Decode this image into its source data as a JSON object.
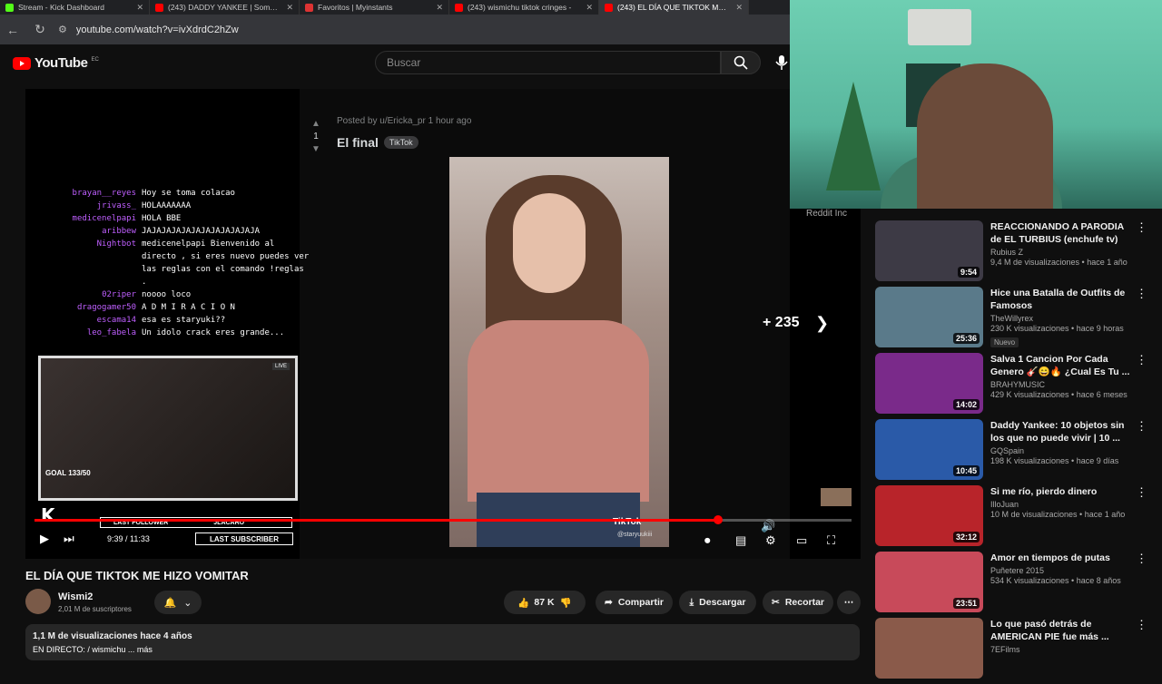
{
  "tabs": [
    {
      "label": "Stream - Kick Dashboard",
      "color": "#53fc18",
      "active": false
    },
    {
      "label": "(243) DADDY YANKEE | Somos ...",
      "color": "#ff0000",
      "active": false
    },
    {
      "label": "Favoritos | Myinstants",
      "color": "#d33",
      "active": false
    },
    {
      "label": "(243) wismichu tiktok cringes -",
      "color": "#ff0000",
      "active": false
    },
    {
      "label": "(243) EL DÍA QUE TIKTOK ME H",
      "color": "#ff0000",
      "active": true
    }
  ],
  "address": {
    "url": "youtube.com/watch?v=ivXdrdC2hZw"
  },
  "header": {
    "logo_text": "YouTube",
    "logo_sup": "EC",
    "search_placeholder": "Buscar"
  },
  "post": {
    "posted_by": "Posted by u/Ericka_pr 1 hour ago",
    "title": "El final",
    "flair": "TikTok",
    "votes": "1",
    "more_count": "+ 235",
    "tiktok_watermark": "TikTok",
    "tiktok_user": "@staryuukiii"
  },
  "chat": [
    {
      "name": "brayan__reyes",
      "text": "Hoy se toma colacao"
    },
    {
      "name": "jrivass_",
      "text": "HOLAAAAAAA"
    },
    {
      "name": "medicenelpapi",
      "text": "HOLA BBE"
    },
    {
      "name": "aribbew",
      "text": "JAJAJAJAJAJAJAJAJAJAJAJA"
    },
    {
      "name": "Nightbot",
      "text": "medicenelpapi Bienvenido al directo , si eres nuevo puedes ver las reglas con el comando !reglas ."
    },
    {
      "name": "02riper",
      "text": "noooo loco"
    },
    {
      "name": "dragogamer50",
      "text": "A D M I R A C I O N"
    },
    {
      "name": "escama14",
      "text": "esa es staryuki??"
    },
    {
      "name": "leo_fabela",
      "text": "Un idolo crack eres grande..."
    }
  ],
  "overlay": {
    "live": "LIVE",
    "goal": "GOAL 133/50",
    "last_follower_label": "LAST FOLLOWER",
    "last_follower_name": "JLACARO",
    "last_subscriber_label": "LAST SUBSCRIBER"
  },
  "player": {
    "time": "9:39 / 11:33",
    "progress_fraction": 0.835
  },
  "video": {
    "title": "EL DÍA QUE TIKTOK ME HIZO VOMITAR",
    "channel": "Wismi2",
    "subscribers": "2,01 M de suscriptores",
    "likes": "87 K",
    "share": "Compartir",
    "download": "Descargar",
    "clip": "Recortar",
    "views_line": "1,1 M de visualizaciones  hace 4 años",
    "live_line": "EN DIRECTO:  / wismichu ... más"
  },
  "sidebar_note": "Reddit Inc",
  "related": [
    {
      "title": "REACCIONANDO A PARODIA de EL TURBIUS (enchufe tv)",
      "channel": "Rubius Z",
      "meta": "9,4 M de visualizaciones • hace 1 año",
      "duration": "9:54",
      "thumb_color": "#3d3a45",
      "badge": ""
    },
    {
      "title": "Hice una Batalla de Outfits de Famosos",
      "channel": "TheWillyrex",
      "meta": "230 K visualizaciones • hace 9 horas",
      "duration": "25:36",
      "thumb_color": "#5a7a8a",
      "badge": "Nuevo"
    },
    {
      "title": "Salva 1 Cancion Por Cada Genero 🎸😄🔥 ¿Cual Es Tu ...",
      "channel": "BRAHYMUSIC",
      "meta": "429 K visualizaciones • hace 6 meses",
      "duration": "14:02",
      "thumb_color": "#7a2a8a",
      "badge": ""
    },
    {
      "title": "Daddy Yankee: 10 objetos sin los que no puede vivir | 10 ...",
      "channel": "GQSpain",
      "meta": "198 K visualizaciones • hace 9 días",
      "duration": "10:45",
      "thumb_color": "#2a5aa8",
      "badge": ""
    },
    {
      "title": "Si me río, pierdo dinero",
      "channel": "IlloJuan",
      "meta": "10 M de visualizaciones • hace 1 año",
      "duration": "32:12",
      "thumb_color": "#b8242a",
      "badge": ""
    },
    {
      "title": "Amor en tiempos de putas",
      "channel": "Puñetere 2015",
      "meta": "534 K visualizaciones • hace 8 años",
      "duration": "23:51",
      "thumb_color": "#c84a5a",
      "badge": ""
    },
    {
      "title": "Lo que pasó detrás de AMERICAN PIE fue más ...",
      "channel": "7EFilms",
      "meta": "",
      "duration": "",
      "thumb_color": "#8a5a4a",
      "badge": ""
    }
  ]
}
